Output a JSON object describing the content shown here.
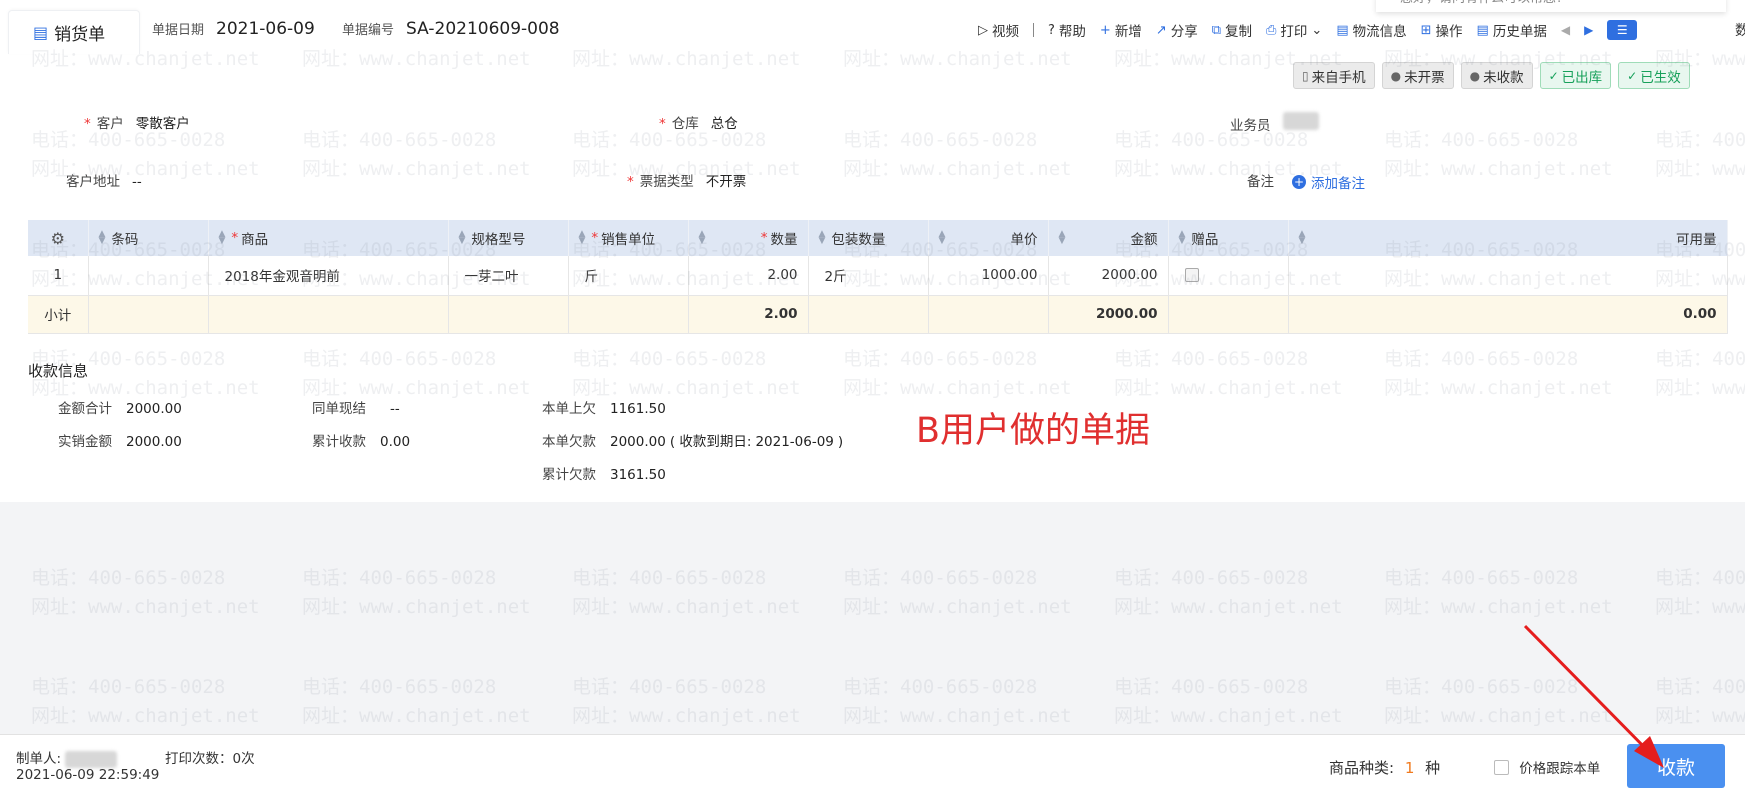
{
  "header": {
    "tab_label": "销货单",
    "date_label": "单据日期",
    "date_value": "2021-06-09",
    "number_label": "单据编号",
    "number_value": "SA-20210609-008"
  },
  "toolbar": {
    "video": "视频",
    "help": "帮助",
    "new": "新增",
    "share": "分享",
    "copy": "复制",
    "print": "打印",
    "logistics": "物流信息",
    "operate": "操作",
    "history": "历史单据"
  },
  "chat_popup_text": "您好，请问有什么可以帮您?",
  "edge_char": "数",
  "status_badges": [
    {
      "label": "来自手机",
      "style": "grey",
      "icon": "mobile-icon"
    },
    {
      "label": "未开票",
      "style": "grey",
      "icon": "alert-icon"
    },
    {
      "label": "未收款",
      "style": "grey",
      "icon": "alert-icon"
    },
    {
      "label": "已出库",
      "style": "green",
      "icon": "check-icon"
    },
    {
      "label": "已生效",
      "style": "green",
      "icon": "check-icon"
    }
  ],
  "form": {
    "customer_label": "客户",
    "customer_value": "零散客户",
    "warehouse_label": "仓库",
    "warehouse_value": "总仓",
    "salesperson_label": "业务员",
    "address_label": "客户地址",
    "address_value": "--",
    "invoice_type_label": "票据类型",
    "invoice_type_value": "不开票",
    "note_label": "备注",
    "add_note": "添加备注"
  },
  "table": {
    "headers": {
      "barcode": "条码",
      "product": "商品",
      "spec": "规格型号",
      "unit": "销售单位",
      "qty": "数量",
      "pack_qty": "包装数量",
      "price": "单价",
      "amount": "金额",
      "gift": "赠品",
      "available": "可用量"
    },
    "rows": [
      {
        "index": "1",
        "barcode": "",
        "product": "2018年金观音明前",
        "spec": "一芽二叶",
        "unit": "斤",
        "qty": "2.00",
        "pack_qty": "2斤",
        "price": "1000.00",
        "amount": "2000.00",
        "available": ""
      }
    ],
    "subtotal": {
      "label": "小计",
      "qty": "2.00",
      "amount": "2000.00",
      "available": "0.00"
    }
  },
  "payment": {
    "title": "收款信息",
    "total_label": "金额合计",
    "total_value": "2000.00",
    "actual_label": "实销金额",
    "actual_value": "2000.00",
    "cash_label": "同单现结",
    "cash_value": "--",
    "cumulative_label": "累计收款",
    "cumulative_value": "0.00",
    "prev_owed_label": "本单上欠",
    "prev_owed_value": "1161.50",
    "owed_label": "本单欠款",
    "owed_value": "2000.00",
    "due_open": "( 收款到期日:",
    "due_date": "2021-06-09",
    "due_close": ")",
    "cum_owed_label": "累计欠款",
    "cum_owed_value": "3161.50"
  },
  "annotation": "B用户做的单据",
  "watermark": {
    "phone": "电话：400-665-0028",
    "site": "网址：www.chanjet.net"
  },
  "footer": {
    "creator_label": "制单人:",
    "print_count": "打印次数：0次",
    "datetime": "2021-06-09 22:59:49",
    "kinds_label": "商品种类:",
    "kinds_value": "1",
    "kinds_unit": "种",
    "price_track": "价格跟踪本单",
    "collect_button": "收款"
  },
  "colors": {
    "accent": "#2f6fe0",
    "button": "#4a90f0",
    "red": "#e03a2f",
    "green": "#17a05a",
    "subtotal_bg": "#fdf8e8",
    "header_bg": "#dfe7f4"
  }
}
